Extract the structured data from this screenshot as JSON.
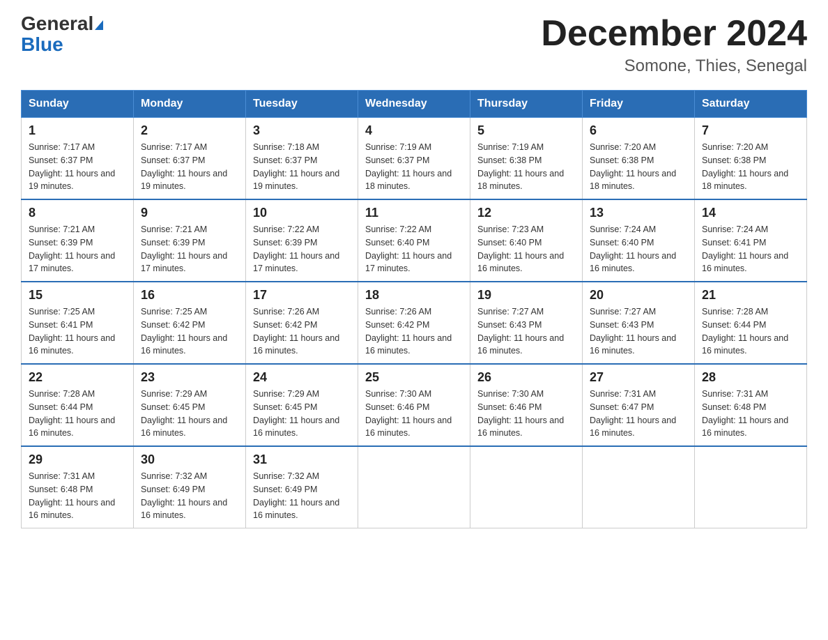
{
  "logo": {
    "general": "General",
    "blue": "Blue"
  },
  "header": {
    "month_year": "December 2024",
    "location": "Somone, Thies, Senegal"
  },
  "weekdays": [
    "Sunday",
    "Monday",
    "Tuesday",
    "Wednesday",
    "Thursday",
    "Friday",
    "Saturday"
  ],
  "weeks": [
    [
      {
        "day": "1",
        "sunrise": "7:17 AM",
        "sunset": "6:37 PM",
        "daylight": "11 hours and 19 minutes."
      },
      {
        "day": "2",
        "sunrise": "7:17 AM",
        "sunset": "6:37 PM",
        "daylight": "11 hours and 19 minutes."
      },
      {
        "day": "3",
        "sunrise": "7:18 AM",
        "sunset": "6:37 PM",
        "daylight": "11 hours and 19 minutes."
      },
      {
        "day": "4",
        "sunrise": "7:19 AM",
        "sunset": "6:37 PM",
        "daylight": "11 hours and 18 minutes."
      },
      {
        "day": "5",
        "sunrise": "7:19 AM",
        "sunset": "6:38 PM",
        "daylight": "11 hours and 18 minutes."
      },
      {
        "day": "6",
        "sunrise": "7:20 AM",
        "sunset": "6:38 PM",
        "daylight": "11 hours and 18 minutes."
      },
      {
        "day": "7",
        "sunrise": "7:20 AM",
        "sunset": "6:38 PM",
        "daylight": "11 hours and 18 minutes."
      }
    ],
    [
      {
        "day": "8",
        "sunrise": "7:21 AM",
        "sunset": "6:39 PM",
        "daylight": "11 hours and 17 minutes."
      },
      {
        "day": "9",
        "sunrise": "7:21 AM",
        "sunset": "6:39 PM",
        "daylight": "11 hours and 17 minutes."
      },
      {
        "day": "10",
        "sunrise": "7:22 AM",
        "sunset": "6:39 PM",
        "daylight": "11 hours and 17 minutes."
      },
      {
        "day": "11",
        "sunrise": "7:22 AM",
        "sunset": "6:40 PM",
        "daylight": "11 hours and 17 minutes."
      },
      {
        "day": "12",
        "sunrise": "7:23 AM",
        "sunset": "6:40 PM",
        "daylight": "11 hours and 16 minutes."
      },
      {
        "day": "13",
        "sunrise": "7:24 AM",
        "sunset": "6:40 PM",
        "daylight": "11 hours and 16 minutes."
      },
      {
        "day": "14",
        "sunrise": "7:24 AM",
        "sunset": "6:41 PM",
        "daylight": "11 hours and 16 minutes."
      }
    ],
    [
      {
        "day": "15",
        "sunrise": "7:25 AM",
        "sunset": "6:41 PM",
        "daylight": "11 hours and 16 minutes."
      },
      {
        "day": "16",
        "sunrise": "7:25 AM",
        "sunset": "6:42 PM",
        "daylight": "11 hours and 16 minutes."
      },
      {
        "day": "17",
        "sunrise": "7:26 AM",
        "sunset": "6:42 PM",
        "daylight": "11 hours and 16 minutes."
      },
      {
        "day": "18",
        "sunrise": "7:26 AM",
        "sunset": "6:42 PM",
        "daylight": "11 hours and 16 minutes."
      },
      {
        "day": "19",
        "sunrise": "7:27 AM",
        "sunset": "6:43 PM",
        "daylight": "11 hours and 16 minutes."
      },
      {
        "day": "20",
        "sunrise": "7:27 AM",
        "sunset": "6:43 PM",
        "daylight": "11 hours and 16 minutes."
      },
      {
        "day": "21",
        "sunrise": "7:28 AM",
        "sunset": "6:44 PM",
        "daylight": "11 hours and 16 minutes."
      }
    ],
    [
      {
        "day": "22",
        "sunrise": "7:28 AM",
        "sunset": "6:44 PM",
        "daylight": "11 hours and 16 minutes."
      },
      {
        "day": "23",
        "sunrise": "7:29 AM",
        "sunset": "6:45 PM",
        "daylight": "11 hours and 16 minutes."
      },
      {
        "day": "24",
        "sunrise": "7:29 AM",
        "sunset": "6:45 PM",
        "daylight": "11 hours and 16 minutes."
      },
      {
        "day": "25",
        "sunrise": "7:30 AM",
        "sunset": "6:46 PM",
        "daylight": "11 hours and 16 minutes."
      },
      {
        "day": "26",
        "sunrise": "7:30 AM",
        "sunset": "6:46 PM",
        "daylight": "11 hours and 16 minutes."
      },
      {
        "day": "27",
        "sunrise": "7:31 AM",
        "sunset": "6:47 PM",
        "daylight": "11 hours and 16 minutes."
      },
      {
        "day": "28",
        "sunrise": "7:31 AM",
        "sunset": "6:48 PM",
        "daylight": "11 hours and 16 minutes."
      }
    ],
    [
      {
        "day": "29",
        "sunrise": "7:31 AM",
        "sunset": "6:48 PM",
        "daylight": "11 hours and 16 minutes."
      },
      {
        "day": "30",
        "sunrise": "7:32 AM",
        "sunset": "6:49 PM",
        "daylight": "11 hours and 16 minutes."
      },
      {
        "day": "31",
        "sunrise": "7:32 AM",
        "sunset": "6:49 PM",
        "daylight": "11 hours and 16 minutes."
      },
      null,
      null,
      null,
      null
    ]
  ],
  "labels": {
    "sunrise": "Sunrise:",
    "sunset": "Sunset:",
    "daylight": "Daylight:"
  }
}
